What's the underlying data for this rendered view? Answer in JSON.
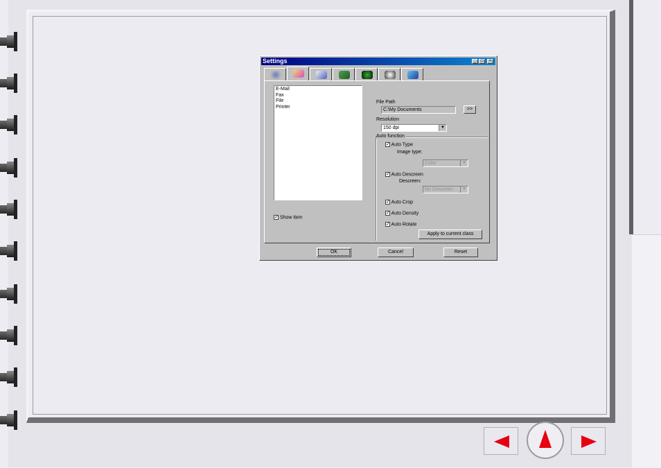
{
  "dialog": {
    "title": "Settings",
    "window_buttons": [
      "_",
      "□",
      "×"
    ],
    "tabs": [
      {
        "icon": "scanner-icon"
      },
      {
        "icon": "mail-icon"
      },
      {
        "icon": "fax-icon"
      },
      {
        "icon": "printer-icon"
      },
      {
        "icon": "ocr-icon"
      },
      {
        "icon": "gear-icon"
      },
      {
        "icon": "arrow-icon"
      }
    ],
    "destinations": [
      "E-Mail",
      "Fax",
      "File",
      "Printer"
    ],
    "show_item_label": "Show item",
    "file_path_label": "File Path",
    "file_path_value": "C:\\My Documents",
    "browse_label": ">>",
    "resolution_label": "Resolution",
    "resolution_value": "150 dpi",
    "auto_function_label": "Auto function",
    "auto_type_label": "Auto Type",
    "image_type_label": "Image type:",
    "image_type_value": "Color",
    "auto_descreen_label": "Auto Descreen",
    "descreen_label": "Descreen:",
    "descreen_value": "No Descreen",
    "auto_crop_label": "Auto Crop",
    "auto_density_label": "Auto Density",
    "auto_rotate_label": "Auto Rotate",
    "apply_label": "Apply to current class",
    "ok_label": "OK",
    "cancel_label": "Cancel",
    "reset_label": "Reset"
  },
  "navigation": {
    "prev_color": "#e60012",
    "home_color": "#e60012",
    "next_color": "#e60012"
  }
}
